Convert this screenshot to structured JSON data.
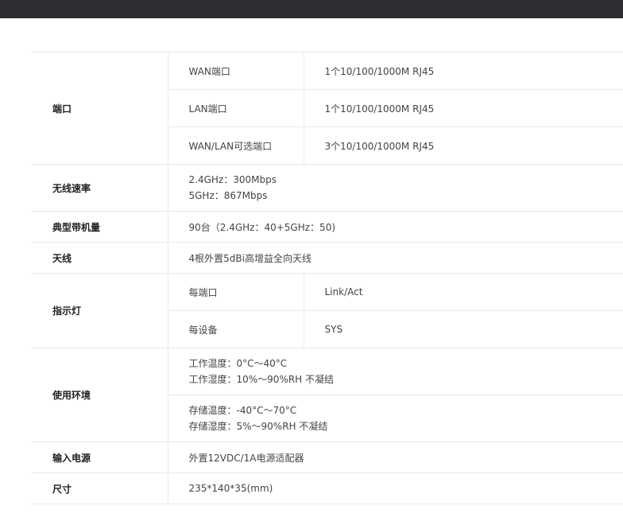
{
  "rows": {
    "port": {
      "label": "端口",
      "items": [
        {
          "name": "WAN端口",
          "value": "1个10/100/1000M RJ45"
        },
        {
          "name": "LAN端口",
          "value": "1个10/100/1000M RJ45"
        },
        {
          "name": "WAN/LAN可选端口",
          "value": "3个10/100/1000M RJ45"
        }
      ]
    },
    "wireless_rate": {
      "label": "无线速率",
      "lines": [
        "2.4GHz：300Mbps",
        "5GHz：867Mbps"
      ]
    },
    "typical_load": {
      "label": "典型带机量",
      "value": "90台（2.4GHz：40+5GHz：50)"
    },
    "antenna": {
      "label": "天线",
      "value": "4根外置5dBi高增益全向天线"
    },
    "indicator": {
      "label": "指示灯",
      "items": [
        {
          "name": "每端口",
          "value": "Link/Act"
        },
        {
          "name": "每设备",
          "value": "SYS"
        }
      ]
    },
    "environment": {
      "label": "使用环境",
      "work_lines": [
        "工作温度：0°C～40°C",
        "工作湿度：10%～90%RH 不凝结"
      ],
      "storage_lines": [
        "存储温度：-40°C～70°C",
        "存储湿度：5%～90%RH 不凝结"
      ]
    },
    "power": {
      "label": "输入电源",
      "value": "外置12VDC/1A电源适配器"
    },
    "size": {
      "label": "尺寸",
      "value": "235*140*35(mm)"
    }
  }
}
